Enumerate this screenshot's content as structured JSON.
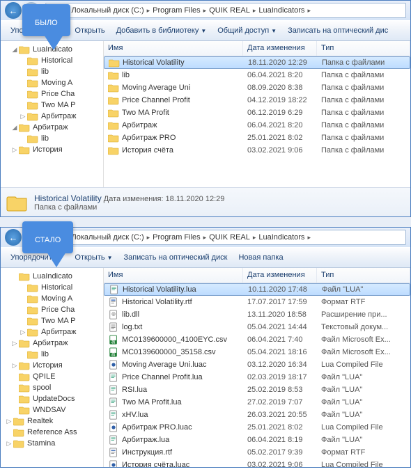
{
  "callout1": "БЫЛО",
  "callout2": "СТАЛО",
  "breadcrumb": [
    "Локальный диск (C:)",
    "Program Files",
    "QUIK REAL",
    "LuaIndicators"
  ],
  "toolbar_a": {
    "organize": "Упорядочить",
    "open": "Открыть",
    "addlib": "Добавить в библиотеку",
    "share": "Общий доступ",
    "burn": "Записать на оптический дис"
  },
  "toolbar_b": {
    "organize": "Упорядочить",
    "open": "Открыть",
    "burn": "Записать на оптический диск",
    "newfolder": "Новая папка"
  },
  "cols": {
    "name": "Имя",
    "date": "Дата изменения",
    "type": "Тип"
  },
  "tree_a": [
    {
      "d": 1,
      "exp": "◢",
      "label": "LuaIndicato"
    },
    {
      "d": 2,
      "exp": "",
      "label": "Historical"
    },
    {
      "d": 2,
      "exp": "",
      "label": "lib"
    },
    {
      "d": 2,
      "exp": "",
      "label": "Moving A"
    },
    {
      "d": 2,
      "exp": "",
      "label": "Price Cha"
    },
    {
      "d": 2,
      "exp": "",
      "label": "Two MA P"
    },
    {
      "d": 2,
      "exp": "▷",
      "label": "Арбитраж"
    },
    {
      "d": 1,
      "exp": "◢",
      "label": "Арбитраж"
    },
    {
      "d": 2,
      "exp": "",
      "label": "lib"
    },
    {
      "d": 1,
      "exp": "▷",
      "label": "История"
    }
  ],
  "tree_b": [
    {
      "d": 1,
      "exp": "",
      "label": "LuaIndicato"
    },
    {
      "d": 2,
      "exp": "",
      "label": "Historical"
    },
    {
      "d": 2,
      "exp": "",
      "label": "Moving A"
    },
    {
      "d": 2,
      "exp": "",
      "label": "Price Cha"
    },
    {
      "d": 2,
      "exp": "",
      "label": "Two MA P"
    },
    {
      "d": 2,
      "exp": "▷",
      "label": "Арбитраж"
    },
    {
      "d": 1,
      "exp": "▷",
      "label": "Арбитраж"
    },
    {
      "d": 2,
      "exp": "",
      "label": "lib"
    },
    {
      "d": 1,
      "exp": "▷",
      "label": "История"
    },
    {
      "d": 1,
      "exp": "",
      "label": "QPILE"
    },
    {
      "d": 1,
      "exp": "",
      "label": "spool"
    },
    {
      "d": 1,
      "exp": "",
      "label": "UpdateDocs"
    },
    {
      "d": 1,
      "exp": "",
      "label": "WNDSAV"
    },
    {
      "d": 0,
      "exp": "▷",
      "label": "Realtek"
    },
    {
      "d": 0,
      "exp": "",
      "label": "Reference Ass"
    },
    {
      "d": 0,
      "exp": "▷",
      "label": "Stamina"
    }
  ],
  "rows_a": [
    {
      "icon": "folder",
      "name": "Historical Volatility",
      "date": "18.11.2020 12:29",
      "type": "Папка с файлами",
      "sel": true
    },
    {
      "icon": "folder",
      "name": "lib",
      "date": "06.04.2021 8:20",
      "type": "Папка с файлами"
    },
    {
      "icon": "folder",
      "name": "Moving Average Uni",
      "date": "08.09.2020 8:38",
      "type": "Папка с файлами"
    },
    {
      "icon": "folder",
      "name": "Price Channel Profit",
      "date": "04.12.2019 18:22",
      "type": "Папка с файлами"
    },
    {
      "icon": "folder",
      "name": "Two MA Profit",
      "date": "06.12.2019 6:29",
      "type": "Папка с файлами"
    },
    {
      "icon": "folder",
      "name": "Арбитраж",
      "date": "06.04.2021 8:20",
      "type": "Папка с файлами"
    },
    {
      "icon": "folder",
      "name": "Арбитраж PRO",
      "date": "25.01.2021 8:02",
      "type": "Папка с файлами"
    },
    {
      "icon": "folder",
      "name": "История счёта",
      "date": "03.02.2021 9:06",
      "type": "Папка с файлами"
    }
  ],
  "details_a": {
    "title": "Historical Volatility",
    "meta1_label": "Дата изменения:",
    "meta1_val": "18.11.2020 12:29",
    "meta2": "Папка с файлами"
  },
  "rows_b": [
    {
      "icon": "lua",
      "name": "Historical Volatility.lua",
      "date": "10.11.2020 17:48",
      "type": "Файл \"LUA\"",
      "sel": true
    },
    {
      "icon": "rtf",
      "name": "Historical Volatility.rtf",
      "date": "17.07.2017 17:59",
      "type": "Формат RTF"
    },
    {
      "icon": "dll",
      "name": "lib.dll",
      "date": "13.11.2020 18:58",
      "type": "Расширение при..."
    },
    {
      "icon": "txt",
      "name": "log.txt",
      "date": "05.04.2021 14:44",
      "type": "Текстовый докум..."
    },
    {
      "icon": "csv",
      "name": "MC0139600000_4100EYC.csv",
      "date": "06.04.2021 7:40",
      "type": "Файл Microsoft Ex..."
    },
    {
      "icon": "csv",
      "name": "MC0139600000_35158.csv",
      "date": "05.04.2021 18:16",
      "type": "Файл Microsoft Ex..."
    },
    {
      "icon": "luac",
      "name": "Moving Average Uni.luac",
      "date": "03.12.2020 16:34",
      "type": "Lua Compiled File"
    },
    {
      "icon": "lua",
      "name": "Price Channel Profit.lua",
      "date": "02.03.2019 18:17",
      "type": "Файл \"LUA\""
    },
    {
      "icon": "lua",
      "name": "RSI.lua",
      "date": "25.02.2019 8:53",
      "type": "Файл \"LUA\""
    },
    {
      "icon": "lua",
      "name": "Two MA Profit.lua",
      "date": "27.02.2019 7:07",
      "type": "Файл \"LUA\""
    },
    {
      "icon": "lua",
      "name": "xHV.lua",
      "date": "26.03.2021 20:55",
      "type": "Файл \"LUA\""
    },
    {
      "icon": "luac",
      "name": "Арбитраж PRO.luac",
      "date": "25.01.2021 8:02",
      "type": "Lua Compiled File"
    },
    {
      "icon": "lua",
      "name": "Арбитраж.lua",
      "date": "06.04.2021 8:19",
      "type": "Файл \"LUA\""
    },
    {
      "icon": "rtf",
      "name": "Инструкция.rtf",
      "date": "05.02.2017 9:39",
      "type": "Формат RTF"
    },
    {
      "icon": "luac",
      "name": "История счёта.luac",
      "date": "03.02.2021 9:06",
      "type": "Lua Compiled File"
    }
  ]
}
